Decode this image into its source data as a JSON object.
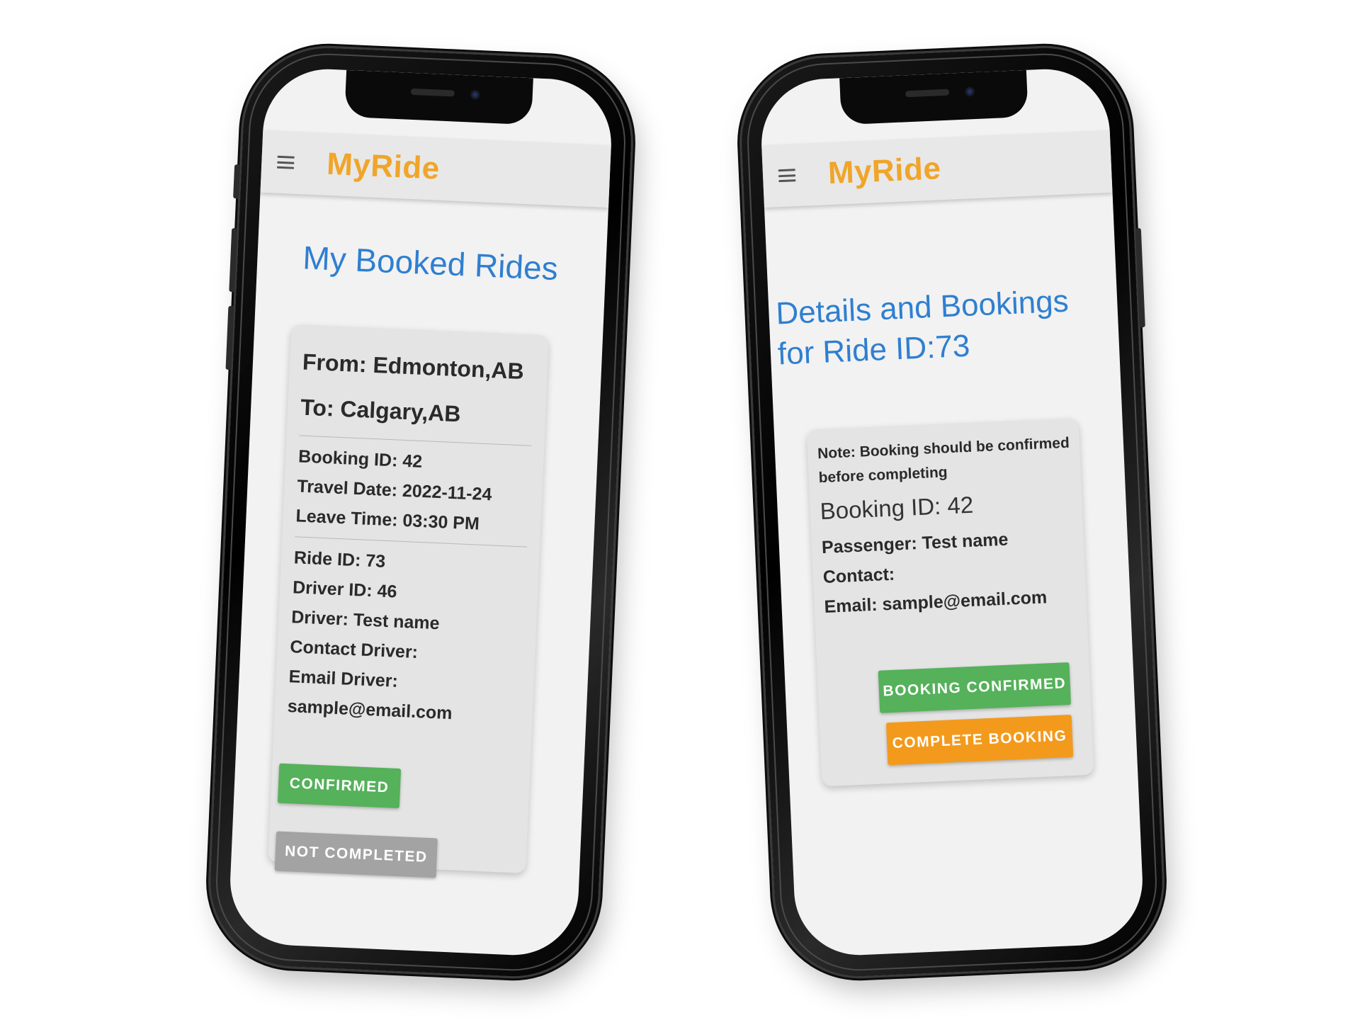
{
  "left_phone": {
    "app_name": "MyRide",
    "page_title": "My Booked Rides",
    "card": {
      "from": "From: Edmonton,AB",
      "to": "To: Calgary,AB",
      "booking_id": "Booking ID: 42",
      "travel_date": "Travel Date: 2022-11-24",
      "leave_time": "Leave Time: 03:30 PM",
      "ride_id": "Ride ID: 73",
      "driver_id": "Driver ID: 46",
      "driver": "Driver: Test name",
      "contact_driver": "Contact Driver:",
      "email_driver": "Email Driver:",
      "email": "sample@email.com",
      "confirmed_label": "CONFIRMED",
      "not_completed_label": "NOT COMPLETED"
    }
  },
  "right_phone": {
    "app_name": "MyRide",
    "page_title_line1": "Details and Bookings",
    "page_title_line2": "for Ride ID:73",
    "card": {
      "note_line1": "Note: Booking should be confirmed",
      "note_line2": "before completing",
      "booking_id": "Booking ID: 42",
      "passenger": "Passenger: Test name",
      "contact": "Contact:",
      "email": "Email: sample@email.com",
      "booking_confirmed_label": "BOOKING CONFIRMED",
      "complete_booking_label": "COMPLETE BOOKING"
    }
  },
  "colors": {
    "logo": "#f0a52a",
    "title": "#2f7fd0",
    "green": "#55b15a",
    "orange": "#f39a1c",
    "grey": "#a3a3a3"
  }
}
